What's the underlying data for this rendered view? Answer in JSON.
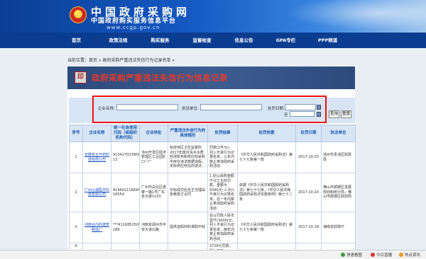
{
  "header": {
    "title": "中国政府采购网",
    "subtitle": "中国政府购买服务信息平台",
    "url": "www.ccgp.gov.cn"
  },
  "nav": [
    "首页",
    "政策法规",
    "购买服务",
    "监督检查",
    "信息公告",
    "GPA专栏",
    "PPP频道"
  ],
  "breadcrumb": "当前位置：首页 » 政府采购严重违法失信行为记录名单 »",
  "banner_title": "政府采购严重违法失信行为信息记录",
  "search": {
    "name_label": "企业名称:",
    "unit_label": "执法单位:",
    "date_label": "处罚日期:",
    "date_sep": "至",
    "search_button": "查询",
    "reset_button": "重置"
  },
  "table": {
    "headers": [
      "序号",
      "企业名称",
      "统一社会信用代码（或组织机构代码）",
      "企业地址",
      "严重违法失信行为的具体情形",
      "处罚结果",
      "处罚依据",
      "处罚日期",
      "执法单位"
    ],
    "rows": [
      [
        "1",
        "安徽省五环药科技有限公司",
        "91341702390929216 13",
        "池州开发区经济管理区工业园B口一厂",
        "有效地区卫生监督所2017年度对清水水质检测机构和供应商采购中存在违法数据造假，实际供应存在的违法...",
        "罚款(1件元)，列入不良行为记录名单，三年内禁止参加政府采购活动",
        "《中华人民共和国政府采购法》第七十七条第一款",
        "2017-10-25",
        "池州市贵池区财政局"
      ],
      [
        "2",
        "广州以诚医疗科技有限公司",
        "91440111669424 16554",
        "广州市白云区景泰一路1号广东省大楼1103",
        "中标成交后无正当理由拒绝签订合同",
        "1.处以采购金额千分之五的罚款，金额为9340元; 2.列入不良行为记录名单，在一年内禁止参加政府采购活动",
        "依据《中华人民共和国政府采购法》第七十七条，《中华人民共和国政府采购法实施条例》第七十二条",
        "2017-10-24",
        "佛山市顺德区发展规划和统计局，佛山市顺德区财政局"
      ],
      [
        "3",
        "河南合内的建筑制造厂",
        "***4116852509 186",
        "河南省郑州市平安大道北路",
        "提供虚假材料谋取中标",
        "处以罚款人民币壹仟(3000)元，列入不良行为记录名单，两年内禁止参加政府采购活动",
        "《中华人民共和国政府采购法》第七十七条第一款",
        "2017-10-18",
        "海南省财政厅"
      ],
      [
        "4",
        "",
        "",
        "",
        "",
        "3728元罚款，列入不良...",
        "",
        "",
        ""
      ]
    ]
  }
}
